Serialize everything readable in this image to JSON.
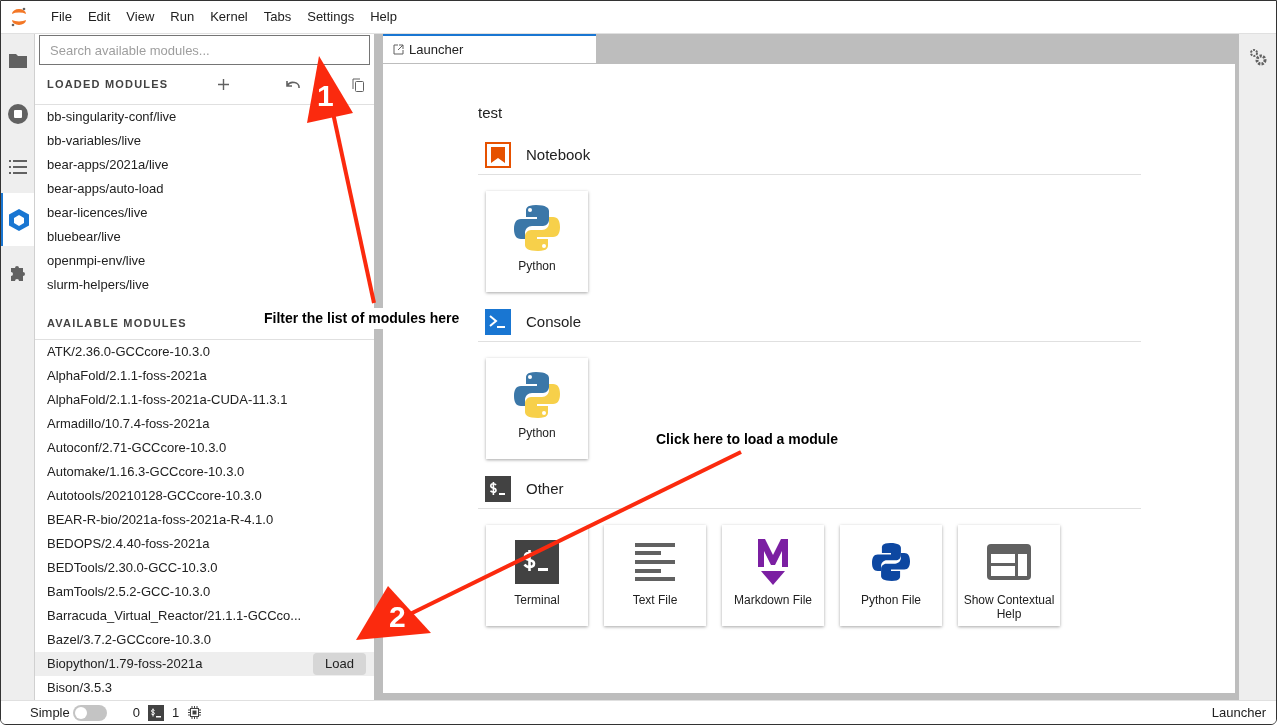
{
  "menu": [
    "File",
    "Edit",
    "View",
    "Run",
    "Kernel",
    "Tabs",
    "Settings",
    "Help"
  ],
  "activity_bar": [
    {
      "kind": "folder",
      "selected": false
    },
    {
      "kind": "stop",
      "selected": false
    },
    {
      "kind": "list",
      "selected": false
    },
    {
      "kind": "modules",
      "selected": true
    },
    {
      "kind": "puzzle",
      "selected": false
    }
  ],
  "search": {
    "placeholder": "Search available modules..."
  },
  "loaded_modules": {
    "title": "LOADED MODULES",
    "items": [
      "bb-singularity-conf/live",
      "bb-variables/live",
      "bear-apps/2021a/live",
      "bear-apps/auto-load",
      "bear-licences/live",
      "bluebear/live",
      "openmpi-env/live",
      "slurm-helpers/live"
    ]
  },
  "available_modules": {
    "title": "AVAILABLE MODULES",
    "load_button": "Load",
    "items": [
      {
        "name": "ATK/2.36.0-GCCcore-10.3.0",
        "hovered": false
      },
      {
        "name": "AlphaFold/2.1.1-foss-2021a",
        "hovered": false
      },
      {
        "name": "AlphaFold/2.1.1-foss-2021a-CUDA-11.3.1",
        "hovered": false
      },
      {
        "name": "Armadillo/10.7.4-foss-2021a",
        "hovered": false
      },
      {
        "name": "Autoconf/2.71-GCCcore-10.3.0",
        "hovered": false
      },
      {
        "name": "Automake/1.16.3-GCCcore-10.3.0",
        "hovered": false
      },
      {
        "name": "Autotools/20210128-GCCcore-10.3.0",
        "hovered": false
      },
      {
        "name": "BEAR-R-bio/2021a-foss-2021a-R-4.1.0",
        "hovered": false
      },
      {
        "name": "BEDOPS/2.4.40-foss-2021a",
        "hovered": false
      },
      {
        "name": "BEDTools/2.30.0-GCC-10.3.0",
        "hovered": false
      },
      {
        "name": "BamTools/2.5.2-GCC-10.3.0",
        "hovered": false
      },
      {
        "name": "Barracuda_Virtual_Reactor/21.1.1-GCCco...",
        "hovered": false
      },
      {
        "name": "Bazel/3.7.2-GCCcore-10.3.0",
        "hovered": false
      },
      {
        "name": "Biopython/1.79-foss-2021a",
        "hovered": true
      },
      {
        "name": "Bison/3.5.3",
        "hovered": false
      }
    ]
  },
  "tabs": [
    {
      "label": "Launcher",
      "selected": true
    }
  ],
  "launcher": {
    "title": "test",
    "sections": [
      {
        "kind": "notebook",
        "title": "Notebook",
        "cards": [
          {
            "kind": "python",
            "label": "Python"
          }
        ]
      },
      {
        "kind": "console",
        "title": "Console",
        "cards": [
          {
            "kind": "python",
            "label": "Python"
          }
        ]
      },
      {
        "kind": "other",
        "title": "Other",
        "cards": [
          {
            "kind": "terminal",
            "label": "Terminal"
          },
          {
            "kind": "text",
            "label": "Text File"
          },
          {
            "kind": "markdown",
            "label": "Markdown File"
          },
          {
            "kind": "pyfile",
            "label": "Python File"
          },
          {
            "kind": "help",
            "label": "Show Contextual Help"
          }
        ]
      }
    ]
  },
  "annotations": [
    {
      "number": "1",
      "caption": "Filter the list of modules here"
    },
    {
      "number": "2",
      "caption": "Click here to load a module"
    }
  ],
  "status_bar": {
    "mode_label": "Simple",
    "simple_on": false,
    "terminals": "0",
    "kernels": "1",
    "current": "Launcher"
  }
}
